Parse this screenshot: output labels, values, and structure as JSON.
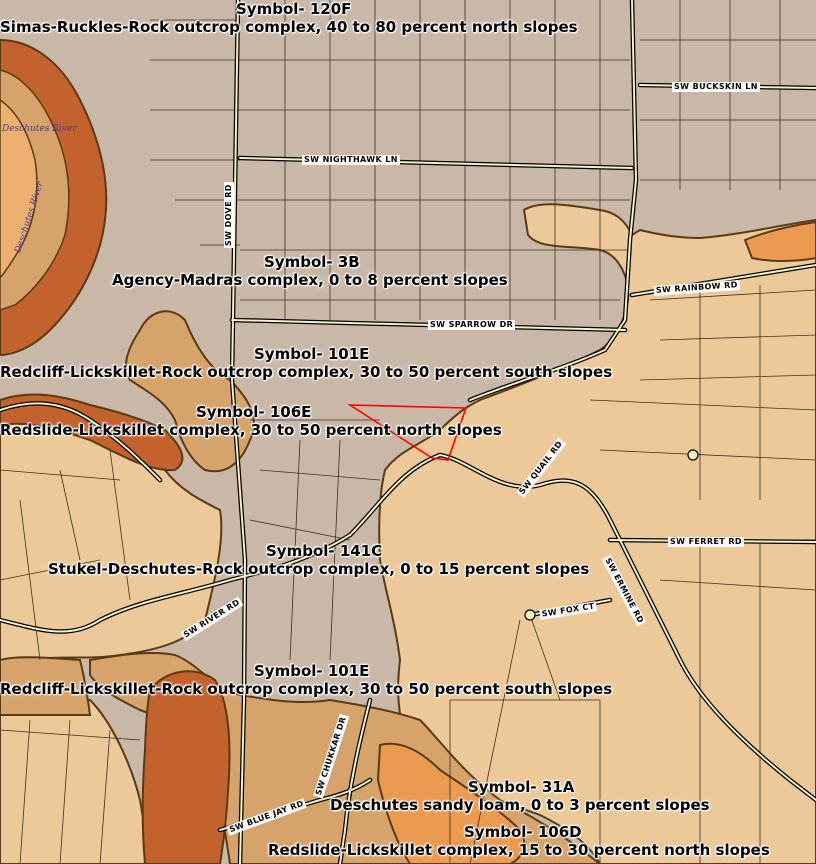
{
  "map": {
    "colors": {
      "residential_gray": "#c9b8a8",
      "light_tan": "#edc898",
      "medium_tan": "#d6a46a",
      "dark_brown": "#c4622e",
      "orange": "#ec9a50",
      "outline": "#5a3a12",
      "road": "#000000",
      "road_fill": "#f5f1c0",
      "parcel_line": "#3d3026",
      "subject_outline": "#ff0000"
    },
    "units": [
      {
        "symbol": "Symbol- 120F",
        "name": "Simas-Ruckles-Rock outcrop complex, 40 to 80 percent north slopes"
      },
      {
        "symbol": "Symbol- 3B",
        "name": "Agency-Madras complex, 0 to 8 percent slopes"
      },
      {
        "symbol": "Symbol- 101E",
        "name": "Redcliff-Lickskillet-Rock outcrop complex, 30 to 50 percent south slopes"
      },
      {
        "symbol": "Symbol- 106E",
        "name": "Redslide-Lickskillet complex, 30 to 50 percent north slopes"
      },
      {
        "symbol": "Symbol- 141C",
        "name": "Stukel-Deschutes-Rock outcrop complex, 0 to 15 percent slopes"
      },
      {
        "symbol": "Symbol- 101E",
        "name": "Redcliff-Lickskillet-Rock outcrop complex, 30 to 50 percent south slopes"
      },
      {
        "symbol": "Symbol- 31A",
        "name": "Deschutes sandy loam, 0 to 3 percent slopes"
      },
      {
        "symbol": "Symbol- 106D",
        "name": "Redslide-Lickskillet complex, 15 to 30 percent north slopes"
      }
    ],
    "roads": [
      "SW BUCKSKIN LN",
      "SW NIGHTHAWK LN",
      "SW DOVE RD",
      "SW RAINBOW RD",
      "SW SPARROW DR",
      "SW QUAIL RD",
      "SW FERRET RD",
      "SW ERMINE RD",
      "SW FOX CT",
      "SW RIVER RD",
      "SW CHUKKAR DR",
      "SW BLUE JAY RD"
    ],
    "river_labels": [
      "Deschutes River",
      "Deschutes River"
    ]
  }
}
